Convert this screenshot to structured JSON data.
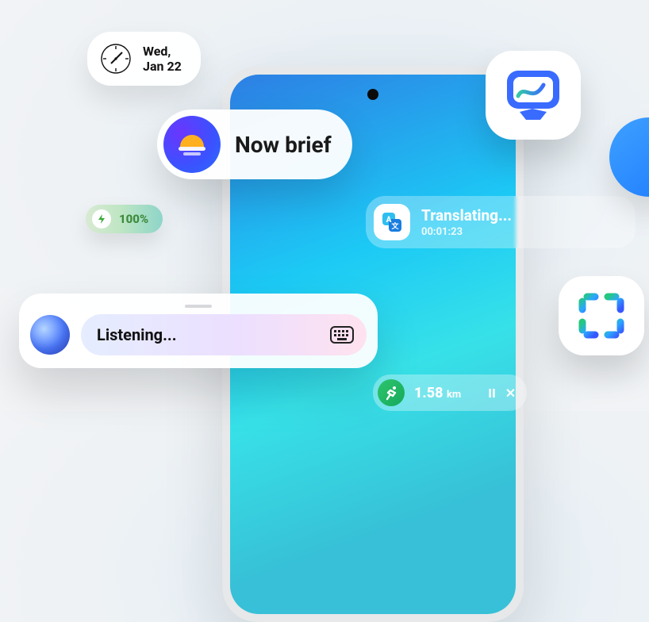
{
  "date": {
    "line1": "Wed,",
    "line2": "Jan 22"
  },
  "nowbrief": {
    "label": "Now brief"
  },
  "battery": {
    "text": "100%"
  },
  "translating": {
    "title": "Translating...",
    "elapsed": "00:01:23"
  },
  "listening": {
    "label": "Listening..."
  },
  "run": {
    "distance": "1.58",
    "units": "km",
    "pause_glyph": "II",
    "close_glyph": "✕"
  },
  "icons": {
    "clock": "analog-clock-icon",
    "sunrise": "sunrise-icon",
    "bolt": "bolt-icon",
    "translate": "translate-icon",
    "keyboard": "keyboard-icon",
    "whiteboard": "whiteboard-icon",
    "scan": "scan-icon",
    "runner": "runner-icon"
  }
}
